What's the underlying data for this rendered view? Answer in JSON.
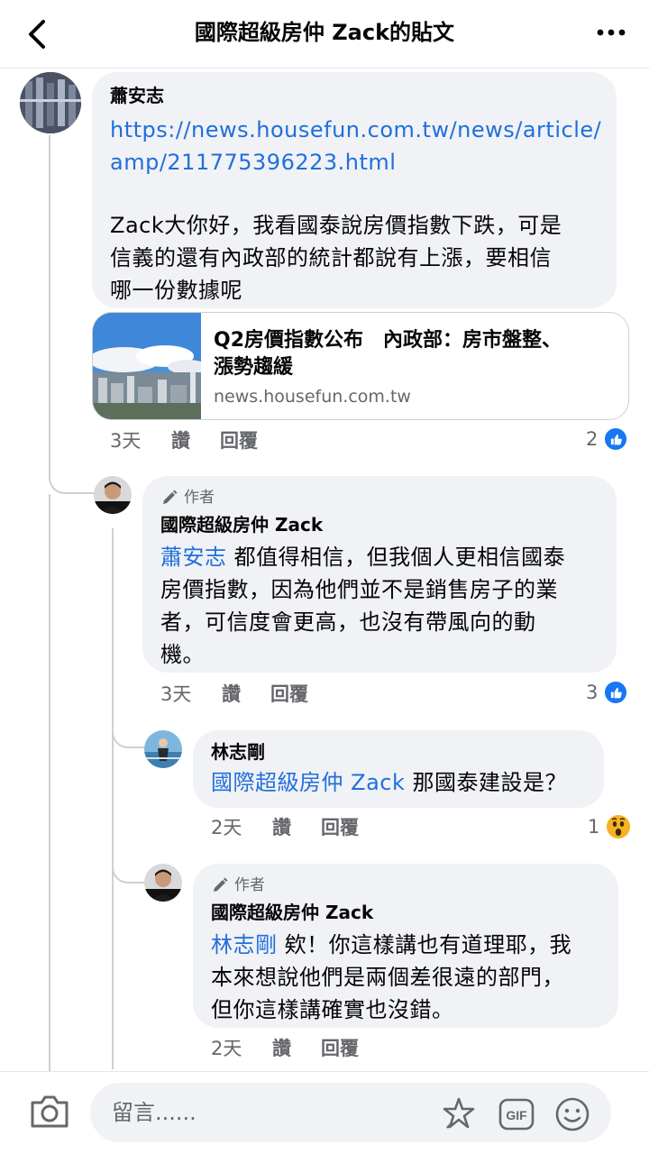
{
  "header": {
    "title": "國際超級房仲 Zack的貼文"
  },
  "comments": [
    {
      "name": "蕭安志",
      "link_line1": "https://news.housefun.com.tw/news/article/",
      "link_line2": "amp/211775396223.html",
      "text_lines": [
        "Zack大你好，我看國泰說房價指數下跌，可是",
        "信義的還有內政部的統計都說有上漲，要相信",
        "哪一份數據呢"
      ],
      "preview": {
        "title_line1": "Q2房價指數公布　內政部：房市盤整、",
        "title_line2": "漲勢趨緩",
        "domain": "news.housefun.com.tw"
      },
      "time": "3天",
      "read": "讚",
      "reply": "回覆",
      "reaction_count": "2"
    },
    {
      "author_tag": "作者",
      "name": "國際超級房仲 Zack",
      "mention": "蕭安志",
      "text_first": " 都值得相信，但我個人更相信國泰",
      "text_lines": [
        "房價指數，因為他們並不是銷售房子的業",
        "者，可信度會更高，也沒有帶風向的動",
        "機。"
      ],
      "time": "3天",
      "read": "讚",
      "reply": "回覆",
      "reaction_count": "3"
    },
    {
      "name": "林志剛",
      "mention": "國際超級房仲 Zack",
      "text_first": " 那國泰建設是？",
      "time": "2天",
      "read": "讚",
      "reply": "回覆",
      "reaction_count": "1"
    },
    {
      "author_tag": "作者",
      "name": "國際超級房仲 Zack",
      "mention": "林志剛",
      "text_first": " 欸！你這樣講也有道理耶，我",
      "text_lines": [
        "本來想說他們是兩個差很遠的部門，",
        "但你這樣講確實也沒錯。"
      ],
      "time": "2天",
      "read": "讚",
      "reply": "回覆"
    }
  ],
  "composer": {
    "placeholder": "留言......"
  },
  "icons": {
    "back": "chevron-left-icon",
    "more": "more-dots-icon",
    "camera": "camera-icon",
    "sticker": "sticker-icon",
    "gif": "gif-icon",
    "emoji": "emoji-icon",
    "like": "like-icon",
    "wow": "wow-icon",
    "pen": "pen-icon"
  },
  "colors": {
    "link": "#216fdb",
    "bubble": "#f0f2f5",
    "like": "#1877f2",
    "muted": "#65676b"
  }
}
